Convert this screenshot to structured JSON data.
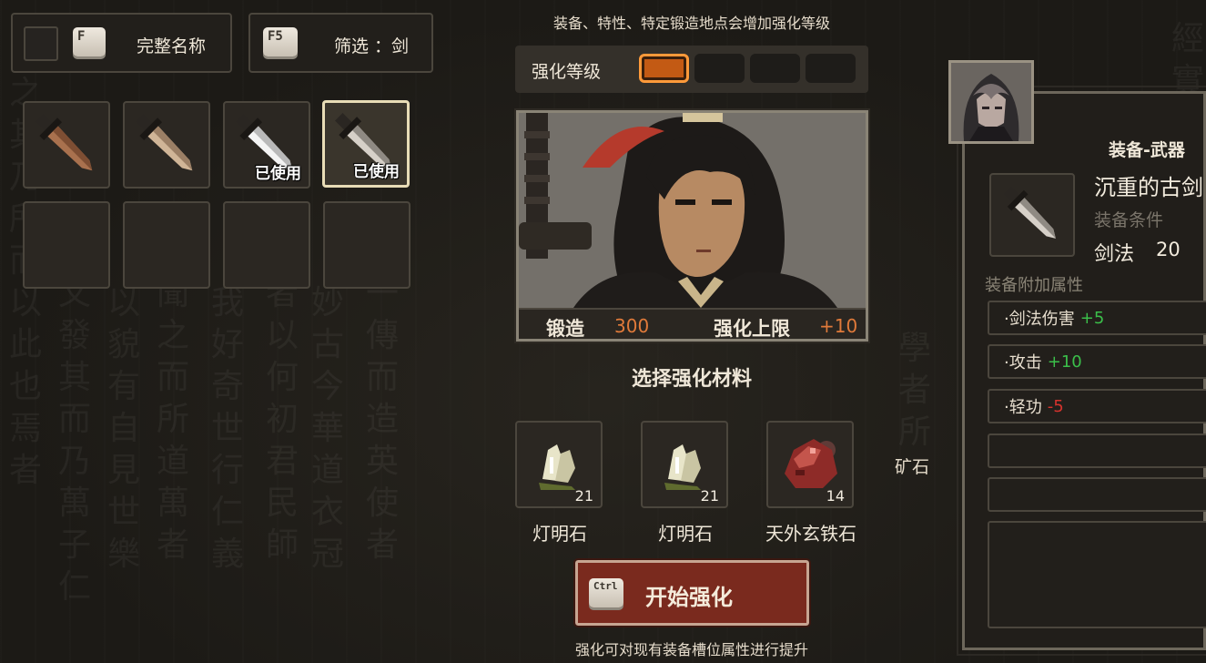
{
  "top_left_bar": {
    "sort_key": "F",
    "sort_label": "完整名称",
    "filter_key": "F5",
    "filter_label": "筛选 ：剑"
  },
  "inventory": {
    "slots": [
      {
        "item": "dagger-brown",
        "used": false,
        "used_label": ""
      },
      {
        "item": "dagger-tan",
        "used": false,
        "used_label": ""
      },
      {
        "item": "dagger-white",
        "used": true,
        "used_label": "已使用"
      },
      {
        "item": "dagger-gray",
        "used": true,
        "used_label": "已使用",
        "selected": true
      }
    ]
  },
  "header_hint": "装备、特性、特定锻造地点会增加强化等级",
  "enhance_level": {
    "label": "强化等级",
    "active": 1,
    "total": 4
  },
  "portrait_bar": {
    "forge_label": "锻造",
    "forge_value": "300",
    "cap_label": "强化上限",
    "cap_value": "+10"
  },
  "select_material_title": "选择强化材料",
  "materials": [
    {
      "name": "灯明石",
      "count": "21",
      "icon": "crystal-icon"
    },
    {
      "name": "灯明石",
      "count": "21",
      "icon": "crystal-icon"
    },
    {
      "name": "天外玄铁石",
      "count": "14",
      "icon": "red-ore-icon"
    }
  ],
  "ore_side_label": "矿石",
  "start_button": {
    "key": "Ctrl",
    "label": "开始强化"
  },
  "footer_hint": "强化可对现有装备槽位属性进行提升",
  "detail": {
    "category": "装备-武器",
    "name": "沉重的古剑",
    "requirement_label": "装备条件",
    "skill_name": "剑法",
    "skill_value": "20",
    "extra_attr_title": "装备附加属性",
    "attrs": [
      {
        "name": "·剑法伤害",
        "value": "+5",
        "kind": "pos"
      },
      {
        "name": "·攻击",
        "value": "+10",
        "kind": "pos"
      },
      {
        "name": "·轻功",
        "value": "-5",
        "kind": "neg"
      },
      {
        "name": "",
        "value": "",
        "kind": ""
      },
      {
        "name": "",
        "value": "",
        "kind": ""
      }
    ]
  },
  "colors": {
    "accent_orange": "#c35a14",
    "button_red": "#7a2a1e",
    "positive": "#3bbf4a",
    "negative": "#d6332d"
  }
}
